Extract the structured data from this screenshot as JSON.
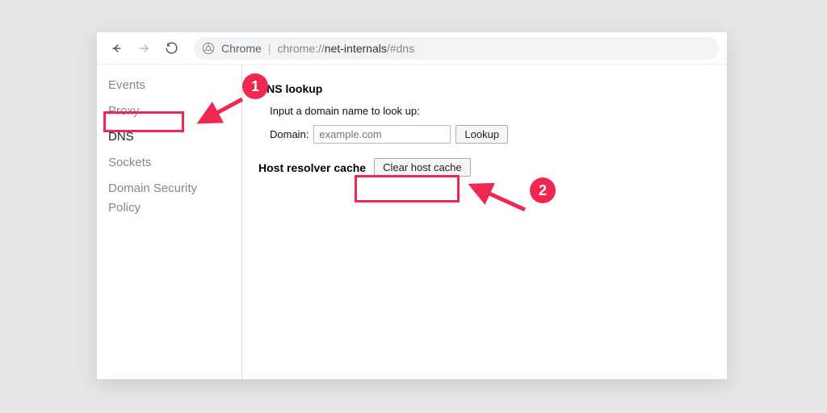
{
  "toolbar": {
    "chrome_label": "Chrome",
    "url_prefix": "chrome://",
    "url_strong": "net-internals",
    "url_suffix": "/#dns"
  },
  "sidebar": {
    "items": [
      {
        "label": "Events"
      },
      {
        "label": "Proxy"
      },
      {
        "label": "DNS"
      },
      {
        "label": "Sockets"
      },
      {
        "label": "Domain Security Policy"
      }
    ],
    "active_index": 2
  },
  "main": {
    "dns_lookup": {
      "title": "DNS lookup",
      "help": "Input a domain name to look up:",
      "domain_label": "Domain:",
      "domain_placeholder": "example.com",
      "lookup_button": "Lookup"
    },
    "host_cache": {
      "label": "Host resolver cache",
      "clear_button": "Clear host cache"
    }
  },
  "annotations": {
    "badge1": "1",
    "badge2": "2",
    "color": "#ee2850"
  }
}
